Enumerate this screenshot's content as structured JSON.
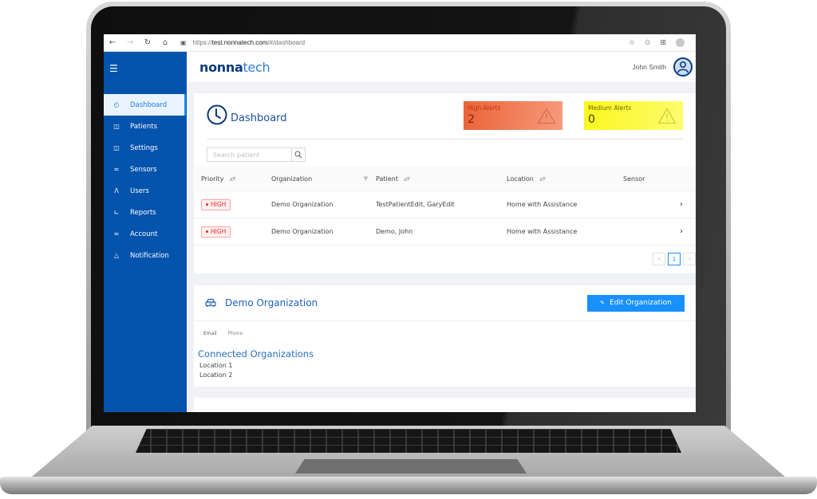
{
  "browser": {
    "url_scheme": "https://",
    "url_host": "test.nonnatech.com",
    "url_path": "/#/dashboard"
  },
  "header": {
    "logo_bold": "nonna",
    "logo_light": "tech",
    "user_name": "John Smith"
  },
  "sidebar": {
    "items": [
      {
        "label": "Dashboard",
        "icon": "dashboard-icon",
        "active": true
      },
      {
        "label": "Patients",
        "icon": "medkit-icon"
      },
      {
        "label": "Settings",
        "icon": "medkit-icon"
      },
      {
        "label": "Sensors",
        "icon": "wifi-icon"
      },
      {
        "label": "Users",
        "icon": "user-icon"
      },
      {
        "label": "Reports",
        "icon": "line-chart-icon"
      },
      {
        "label": "Account",
        "icon": "wifi-icon"
      },
      {
        "label": "Notification",
        "icon": "bell-icon"
      }
    ]
  },
  "dashboard": {
    "title": "Dashboard",
    "alerts": {
      "high": {
        "label": "High Alerts",
        "count": "2",
        "color": "#ec6237"
      },
      "medium": {
        "label": "Medium Alerts",
        "count": "0",
        "color": "#fbf71d"
      }
    },
    "search": {
      "placeholder": "Search patient",
      "value": ""
    },
    "table": {
      "columns": [
        "Priority",
        "Organization",
        "Patient",
        "Location",
        "Sensor"
      ],
      "rows": [
        {
          "priority": "HIGH",
          "organization": "Demo Organization",
          "patient": "TestPatientEdit, GaryEdit",
          "location": "Home with Assistance",
          "sensor": ""
        },
        {
          "priority": "HIGH",
          "organization": "Demo Organization",
          "patient": "Demo, John",
          "location": "Home with Assistance",
          "sensor": ""
        }
      ]
    },
    "pagination": {
      "prev": "<",
      "current": "1",
      "next": ">"
    }
  },
  "organization": {
    "title": "Demo Organization",
    "edit_label": "Edit Organization",
    "email_label": "Email",
    "phone_label": "Phone",
    "connected_title": "Connected Organizations",
    "locations": [
      "Location 1",
      "Location 2"
    ]
  },
  "colors": {
    "sidebar": "#0453ad",
    "primary": "#1890ff",
    "badge_high": "#f5222d"
  }
}
